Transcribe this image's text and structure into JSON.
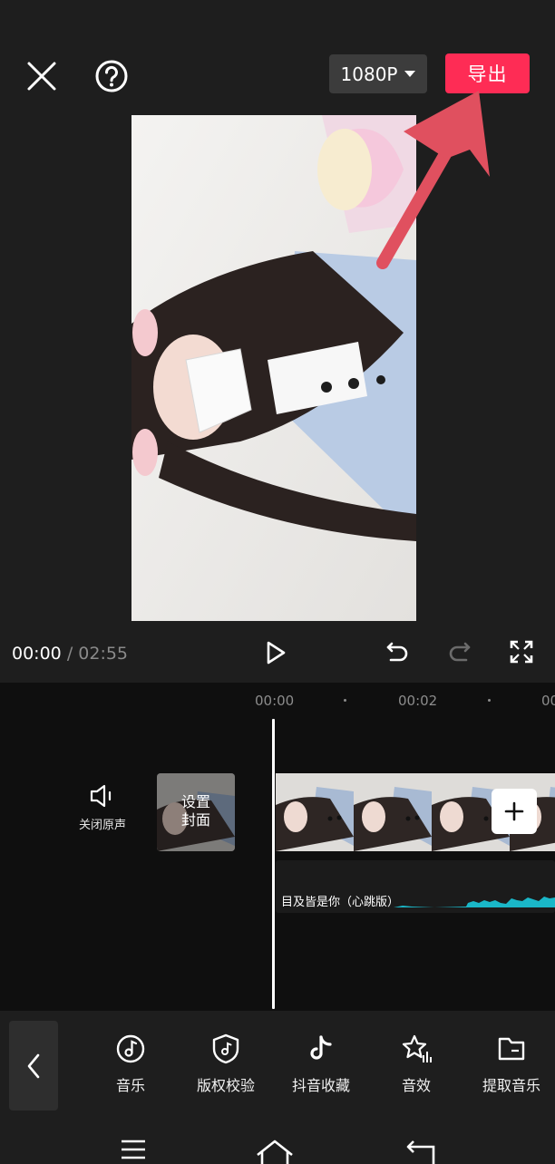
{
  "header": {
    "resolution_label": "1080P",
    "export_label": "导出",
    "accent_color": "#fe2c55"
  },
  "icons": {
    "close": "close-icon",
    "help": "help-icon",
    "play": "play-icon",
    "undo": "undo-icon",
    "redo": "redo-icon",
    "fullscreen": "fullscreen-icon"
  },
  "player": {
    "current_time": "00:00",
    "separator": "/",
    "duration": "02:55"
  },
  "timeline": {
    "ticks": [
      "00:00",
      "00:02",
      "00"
    ],
    "mute_label": "关闭原声",
    "cover_label_line1": "设置",
    "cover_label_line2": "封面",
    "audio_track_label": "目及皆是你（心跳版）",
    "waveform_color": "#1ab7c8"
  },
  "toolbar": {
    "items": [
      {
        "label": "音乐",
        "icon": "music-icon"
      },
      {
        "label": "版权校验",
        "icon": "copyright-shield-icon"
      },
      {
        "label": "抖音收藏",
        "icon": "tiktok-icon"
      },
      {
        "label": "音效",
        "icon": "sound-effect-icon"
      },
      {
        "label": "提取音乐",
        "icon": "folder-icon"
      }
    ]
  },
  "nav": {
    "items": [
      "menu-icon",
      "home-icon",
      "back-icon"
    ]
  }
}
